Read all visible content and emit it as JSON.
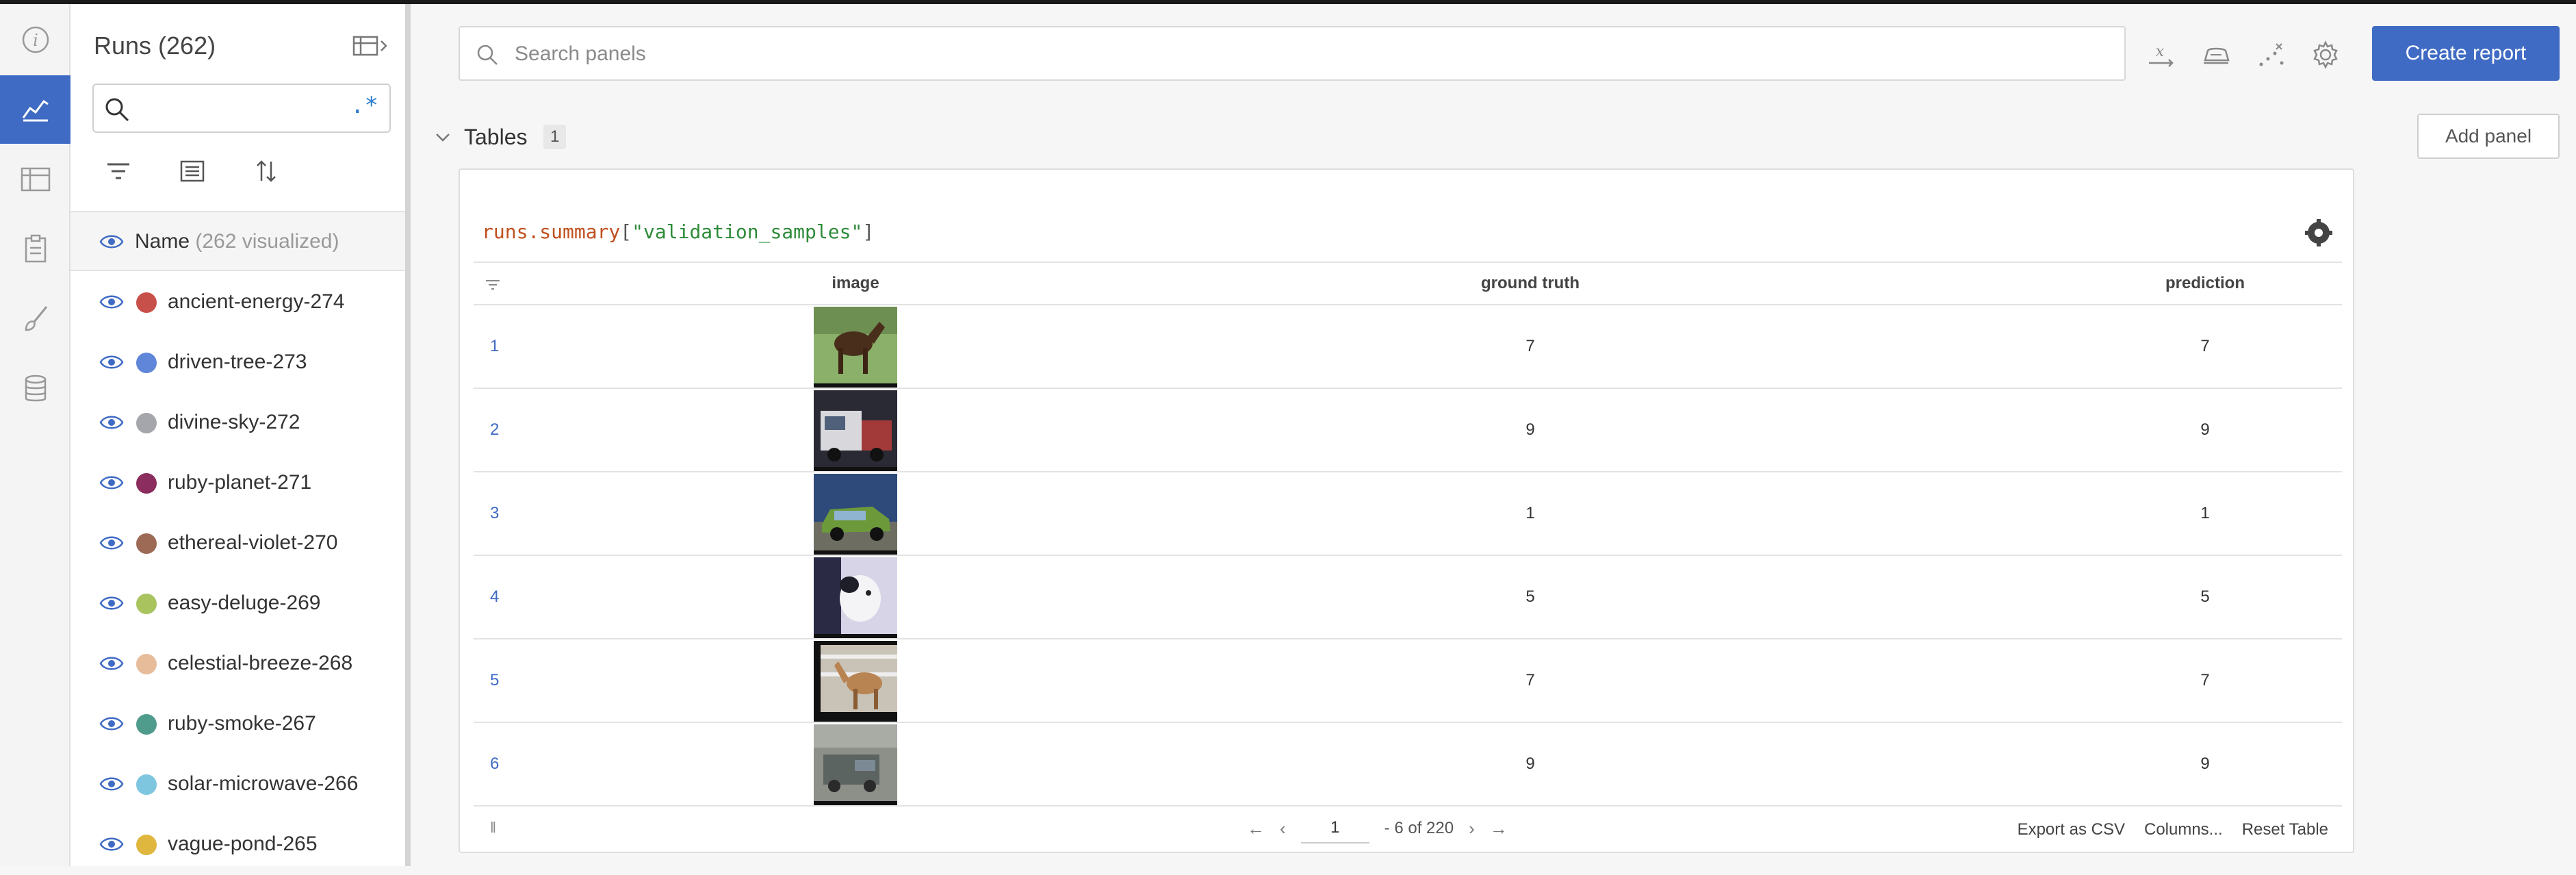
{
  "rail": {
    "icons": [
      "info-icon",
      "chart-icon",
      "table-icon",
      "clipboard-icon",
      "brush-icon",
      "database-icon"
    ],
    "active_index": 1,
    "active_color": "#3f6bc4"
  },
  "sidebar": {
    "title": "Runs (262)",
    "search_value": "",
    "regex_label": ".*",
    "name_header": {
      "label": "Name",
      "sub": "(262 visualized)"
    },
    "runs": [
      {
        "name": "ancient-energy-274",
        "color": "#c8504a"
      },
      {
        "name": "driven-tree-273",
        "color": "#5f86d8"
      },
      {
        "name": "divine-sky-272",
        "color": "#a4a6ab"
      },
      {
        "name": "ruby-planet-271",
        "color": "#8b2d5e"
      },
      {
        "name": "ethereal-violet-270",
        "color": "#9c6a55"
      },
      {
        "name": "easy-deluge-269",
        "color": "#a9c35f"
      },
      {
        "name": "celestial-breeze-268",
        "color": "#e6bc9b"
      },
      {
        "name": "ruby-smoke-267",
        "color": "#4f9b8c"
      },
      {
        "name": "solar-microwave-266",
        "color": "#7ec6e0"
      },
      {
        "name": "vague-pond-265",
        "color": "#e0b73e"
      }
    ]
  },
  "header": {
    "search_placeholder": "Search panels",
    "create_report": "Create report",
    "icons": [
      "x-axis-icon",
      "smoothing-icon",
      "outliers-icon",
      "settings-icon"
    ]
  },
  "section": {
    "title": "Tables",
    "count": "1",
    "add_panel": "Add panel"
  },
  "panel": {
    "expr_key": "runs.summary",
    "expr_open": "[",
    "expr_str": "\"validation_samples\"",
    "expr_close": "]",
    "columns": [
      "image",
      "ground truth",
      "prediction"
    ],
    "rows": [
      {
        "index": "1",
        "ground_truth": "7",
        "prediction": "7"
      },
      {
        "index": "2",
        "ground_truth": "9",
        "prediction": "9"
      },
      {
        "index": "3",
        "ground_truth": "1",
        "prediction": "1"
      },
      {
        "index": "4",
        "ground_truth": "5",
        "prediction": "5"
      },
      {
        "index": "5",
        "ground_truth": "7",
        "prediction": "7"
      },
      {
        "index": "6",
        "ground_truth": "9",
        "prediction": "9"
      }
    ],
    "pager": {
      "page": "1",
      "range": "- 6 of 220"
    },
    "actions": [
      "Export as CSV",
      "Columns...",
      "Reset Table"
    ]
  }
}
